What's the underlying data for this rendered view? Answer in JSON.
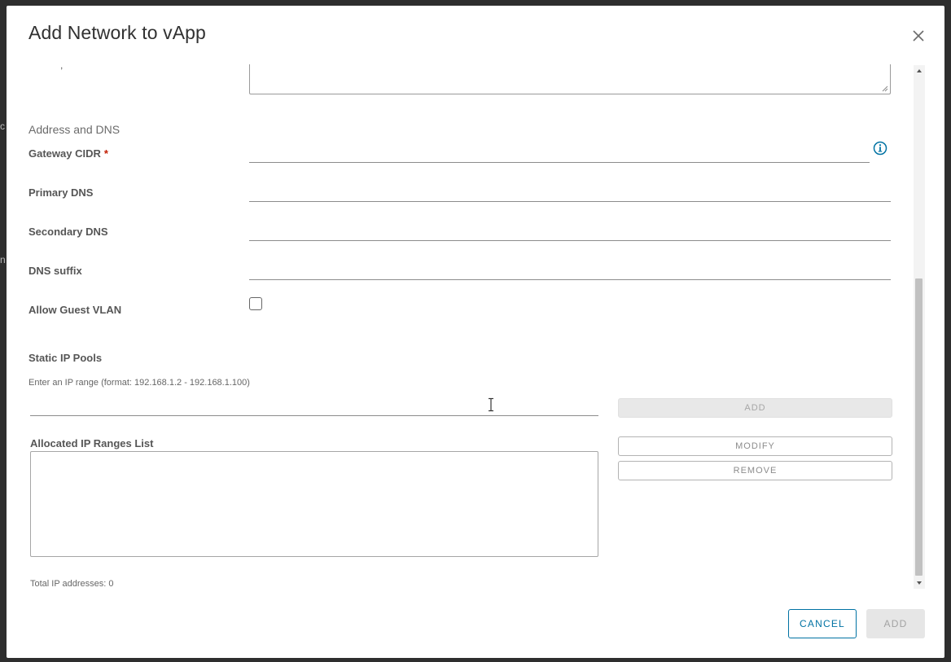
{
  "dialog": {
    "title": "Add Network to vApp"
  },
  "description_fragment": ",",
  "address_dns": {
    "section_title": "Address and DNS",
    "gateway_cidr_label": "Gateway CIDR",
    "required_marker": "*",
    "gateway_cidr_value": "",
    "primary_dns_label": "Primary DNS",
    "primary_dns_value": "",
    "secondary_dns_label": "Secondary DNS",
    "secondary_dns_value": "",
    "dns_suffix_label": "DNS suffix",
    "dns_suffix_value": "",
    "allow_guest_vlan_label": "Allow Guest VLAN",
    "allow_guest_vlan_checked": false
  },
  "static_ip_pools": {
    "section_title": "Static IP Pools",
    "range_hint": "Enter an IP range (format: 192.168.1.2 - 192.168.1.100)",
    "range_value": "",
    "add_label": "ADD",
    "modify_label": "MODIFY",
    "remove_label": "REMOVE",
    "list_label": "Allocated IP Ranges List",
    "ranges": [],
    "total_text": "Total IP addresses: 0"
  },
  "footer": {
    "cancel_label": "CANCEL",
    "add_label": "ADD"
  },
  "colors": {
    "accent": "#0072a3",
    "required": "#c21d00",
    "disabled_bg": "#e6e6e6"
  },
  "icons": {
    "close": "close-icon",
    "info": "info-icon",
    "scroll_up": "chevron-up-icon",
    "scroll_down": "chevron-down-icon",
    "text_cursor": "text-cursor-icon"
  }
}
